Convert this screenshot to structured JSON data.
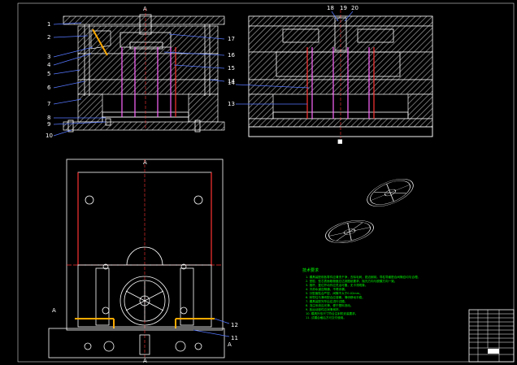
{
  "front_view": {
    "left_labels": [
      "1",
      "2",
      "3",
      "4",
      "5",
      "6",
      "7",
      "8",
      "9",
      "10"
    ],
    "right_labels": [
      "17",
      "16",
      "15",
      "14"
    ],
    "top_mark": "A"
  },
  "side_view": {
    "top_labels": [
      "18",
      "19",
      "20"
    ],
    "side_labels": [
      "14",
      "13"
    ]
  },
  "plan_view": {
    "labels": [
      "12",
      "11"
    ],
    "section_mark": "A"
  },
  "notes": {
    "title": "技术要求",
    "lines": [
      "1. 模具装配前各零件应清洗干净，去除毛刺，锐边倒钝，导柱导套配合间隙应均匀合理。",
      "2. 型腔、型芯表面粗糙度应达到图纸要求，抛光方向与脱模方向一致。",
      "3. 推杆、复位杆动作应灵活可靠，无卡滞现象。",
      "4. 冷却水道应畅通，不得渗漏。",
      "5. 分型面贴合严密，间隙不大于0.02mm。",
      "6. 斜导柱与滑块配合应准确，滑块移动平稳。",
      "7. 模具装配完毕后应进行试模。",
      "8. 浇注系统应光滑，便于塑料流动。",
      "9. 各运动部件应润滑良好。",
      "10. 模具外形尺寸符合注射机安装要求。",
      "11. 试模合格后方可交付使用。"
    ]
  },
  "title_block": {
    "rows": [
      "",
      "",
      "",
      "",
      "",
      "",
      "",
      "",
      "",
      "",
      "",
      ""
    ]
  },
  "colors": {
    "background": "#000000",
    "line": "#ffffff",
    "pin": "#ff66ff",
    "centerline": "#ff3333",
    "leader": "#5577ff",
    "notes": "#00ff00",
    "slider": "#ffaa00"
  }
}
